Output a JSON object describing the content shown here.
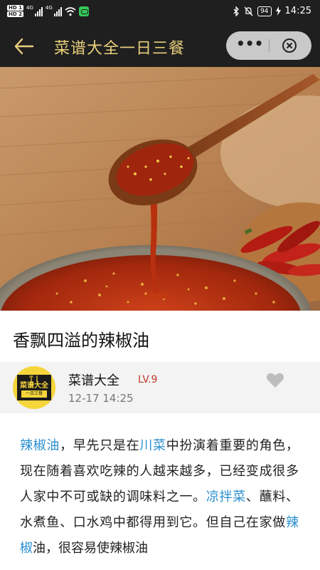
{
  "status_bar": {
    "hd1": "HD 1",
    "hd2": "HD 2",
    "net1": "4G",
    "net2": "4G",
    "battery": "94",
    "time": "14:25"
  },
  "nav": {
    "title": "菜谱大全一日三餐",
    "more_icon": "more-dots-icon",
    "close_icon": "circle-close-icon"
  },
  "article": {
    "title": "香飘四溢的辣椒油",
    "author": {
      "name": "菜谱大全",
      "level": "LV.9",
      "time": "12-17 14:25",
      "avatar_text_top": "菜谱大全",
      "avatar_text_bottom": "一日三餐"
    },
    "body": [
      {
        "t": "辣椒油",
        "k": true
      },
      {
        "t": "，早先只是在",
        "k": false
      },
      {
        "t": "川菜",
        "k": true
      },
      {
        "t": "中扮演着重要的角色，现在随着喜欢吃辣的人越来越多，已经变成很多人家中不可或缺的调味料之一。",
        "k": false
      },
      {
        "t": "凉拌菜",
        "k": true
      },
      {
        "t": "、蘸料、水煮鱼、口水鸡中都得用到它。但自己在家做",
        "k": false
      },
      {
        "t": "辣椒",
        "k": true
      },
      {
        "t": "油，很容易使辣椒油",
        "k": false
      }
    ]
  },
  "colors": {
    "bar_bg": "#1f1f1f",
    "title_gold": "#e9cf7c",
    "keyword_blue": "#2a8fd0",
    "level_red": "#c0392b"
  }
}
